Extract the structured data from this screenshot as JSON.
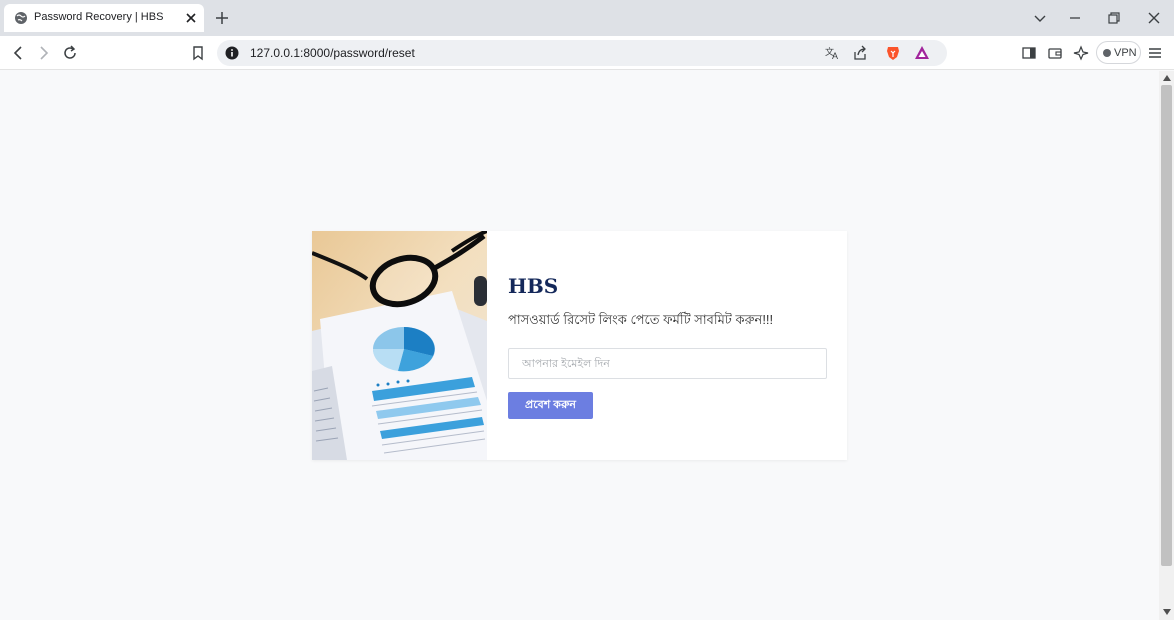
{
  "browser": {
    "tab_title": "Password Recovery | HBS",
    "url": "127.0.0.1:8000/password/reset",
    "vpn_label": "VPN"
  },
  "icons": {
    "tab_favicon": "globe-icon",
    "tab_close": "close-icon",
    "new_tab": "plus-icon",
    "back": "back-arrow-icon",
    "forward": "forward-arrow-icon",
    "reload": "reload-icon",
    "bookmark": "bookmark-icon",
    "site_info": "info-icon",
    "translate": "translate-icon",
    "share": "share-icon",
    "brave_shield": "brave-lion-icon",
    "rewards": "brave-rewards-icon",
    "sidebar": "sidebar-icon",
    "wallet": "wallet-icon",
    "leo": "leo-ai-icon",
    "menu": "hamburger-menu-icon"
  },
  "colors": {
    "brand_text": "#14285a",
    "button_bg": "#6c7ee1",
    "brave_orange": "#fb542b"
  },
  "form": {
    "brand": "HBS",
    "subtitle": "পাসওয়ার্ড রিসেট লিংক পেতে ফর্মটি সাবমিট করুন!!!",
    "email_placeholder": "আপনার ইমেইল দিন",
    "email_value": "",
    "submit_label": "প্রবেশ করুন"
  }
}
